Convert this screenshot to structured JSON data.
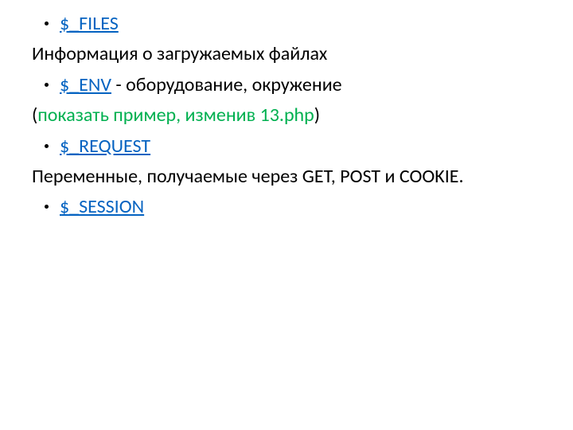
{
  "items": {
    "b1": {
      "link": "$_FILES"
    },
    "p1": "Информация о загружаемых файлах",
    "b2": {
      "link": "$_ENV",
      "tail": "  - оборудование, окружение"
    },
    "p2": {
      "open": "(",
      "green": "показать пример, изменив 13.php",
      "close": ")"
    },
    "b3": {
      "link": "$_REQUEST"
    },
    "p3": "Переменные, получаемые через GET, POST и COOKIE.",
    "b4": {
      "link": "$_SESSION"
    }
  }
}
